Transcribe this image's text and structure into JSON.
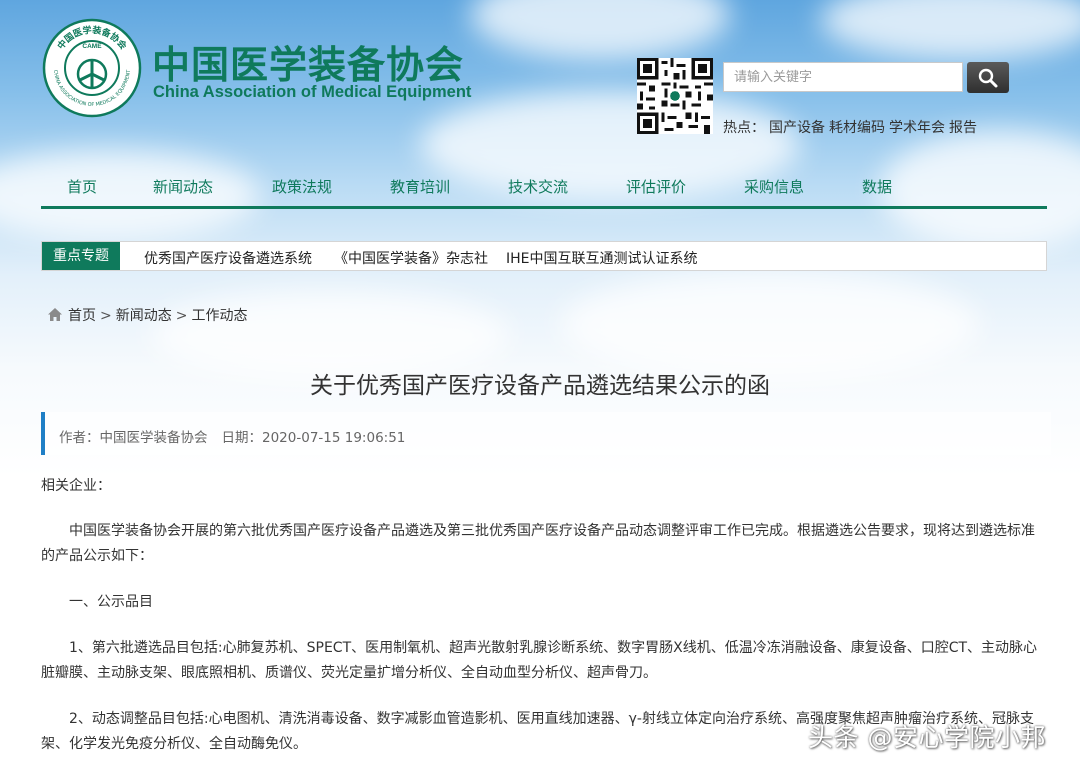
{
  "header": {
    "org_cn": "中国医学装备协会",
    "org_en": "China Association of Medical Equipment",
    "logo": {
      "ring_top_text": "中国医学装备协会",
      "ring_bottom_text": "CHINA ASSOCIATION OF MEDICAL EQUIPMENT",
      "center_text": "CAME",
      "color": "#0f7a5c"
    },
    "search": {
      "placeholder": "请输入关键字",
      "button_icon": "search-icon"
    },
    "hot": {
      "label": "热点：",
      "links": [
        "国产设备",
        "耗材编码",
        "学术年会",
        "报告"
      ]
    }
  },
  "nav": {
    "items": [
      "首页",
      "新闻动态",
      "政策法规",
      "教育培训",
      "技术交流",
      "评估评价",
      "采购信息",
      "数据"
    ]
  },
  "topics": {
    "label": "重点专题",
    "items": [
      "优秀国产医疗设备遴选系统",
      "《中国医学装备》杂志社",
      "IHE中国互联互通测试认证系统"
    ]
  },
  "breadcrumb": {
    "icon": "home-icon",
    "items": [
      "首页",
      "新闻动态",
      "工作动态"
    ],
    "separator": ">"
  },
  "article": {
    "title": "关于优秀国产医疗设备产品遴选结果公示的函",
    "author_label": "作者：",
    "author": "中国医学装备协会",
    "date_label": "日期：",
    "date": "2020-07-15 19:06:51",
    "paragraphs": [
      "相关企业：",
      "中国医学装备协会开展的第六批优秀国产医疗设备产品遴选及第三批优秀国产医疗设备产品动态调整评审工作已完成。根据遴选公告要求，现将达到遴选标准的产品公示如下：",
      "一、公示品目",
      "1、第六批遴选品目包括:心肺复苏机、SPECT、医用制氧机、超声光散射乳腺诊断系统、数字胃肠X线机、低温冷冻消融设备、康复设备、口腔CT、主动脉心脏瓣膜、主动脉支架、眼底照相机、质谱仪、荧光定量扩增分析仪、全自动血型分析仪、超声骨刀。",
      "2、动态调整品目包括:心电图机、清洗消毒设备、数字减影血管造影机、医用直线加速器、γ-射线立体定向治疗系统、高强度聚焦超声肿瘤治疗系统、冠脉支架、化学发光免疫分析仪、全自动酶免仪。"
    ]
  },
  "watermark": "头条 @安心学院小邦"
}
